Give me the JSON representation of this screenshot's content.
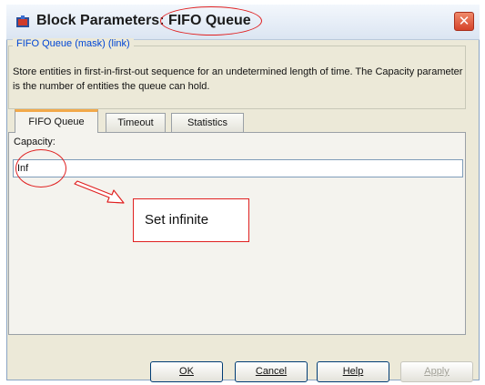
{
  "window": {
    "title": "Block Parameters: FIFO Queue",
    "close_glyph": "✕",
    "icon": "simulink-block-icon"
  },
  "mask": {
    "group_title": "FIFO Queue (mask) (link)",
    "description": "Store entities in first-in-first-out sequence for an undetermined length of time. The Capacity parameter is the number of entities the queue can hold."
  },
  "tabs": [
    {
      "label": "FIFO Queue",
      "active": true
    },
    {
      "label": "Timeout",
      "active": false
    },
    {
      "label": "Statistics",
      "active": false
    }
  ],
  "capacity": {
    "label": "Capacity:",
    "value": "Inf"
  },
  "annotation": {
    "callout_text": "Set infinite",
    "color": "#e02020"
  },
  "buttons": [
    {
      "label": "OK",
      "enabled": true
    },
    {
      "label": "Cancel",
      "enabled": true
    },
    {
      "label": "Help",
      "enabled": true
    },
    {
      "label": "Apply",
      "enabled": false
    }
  ]
}
